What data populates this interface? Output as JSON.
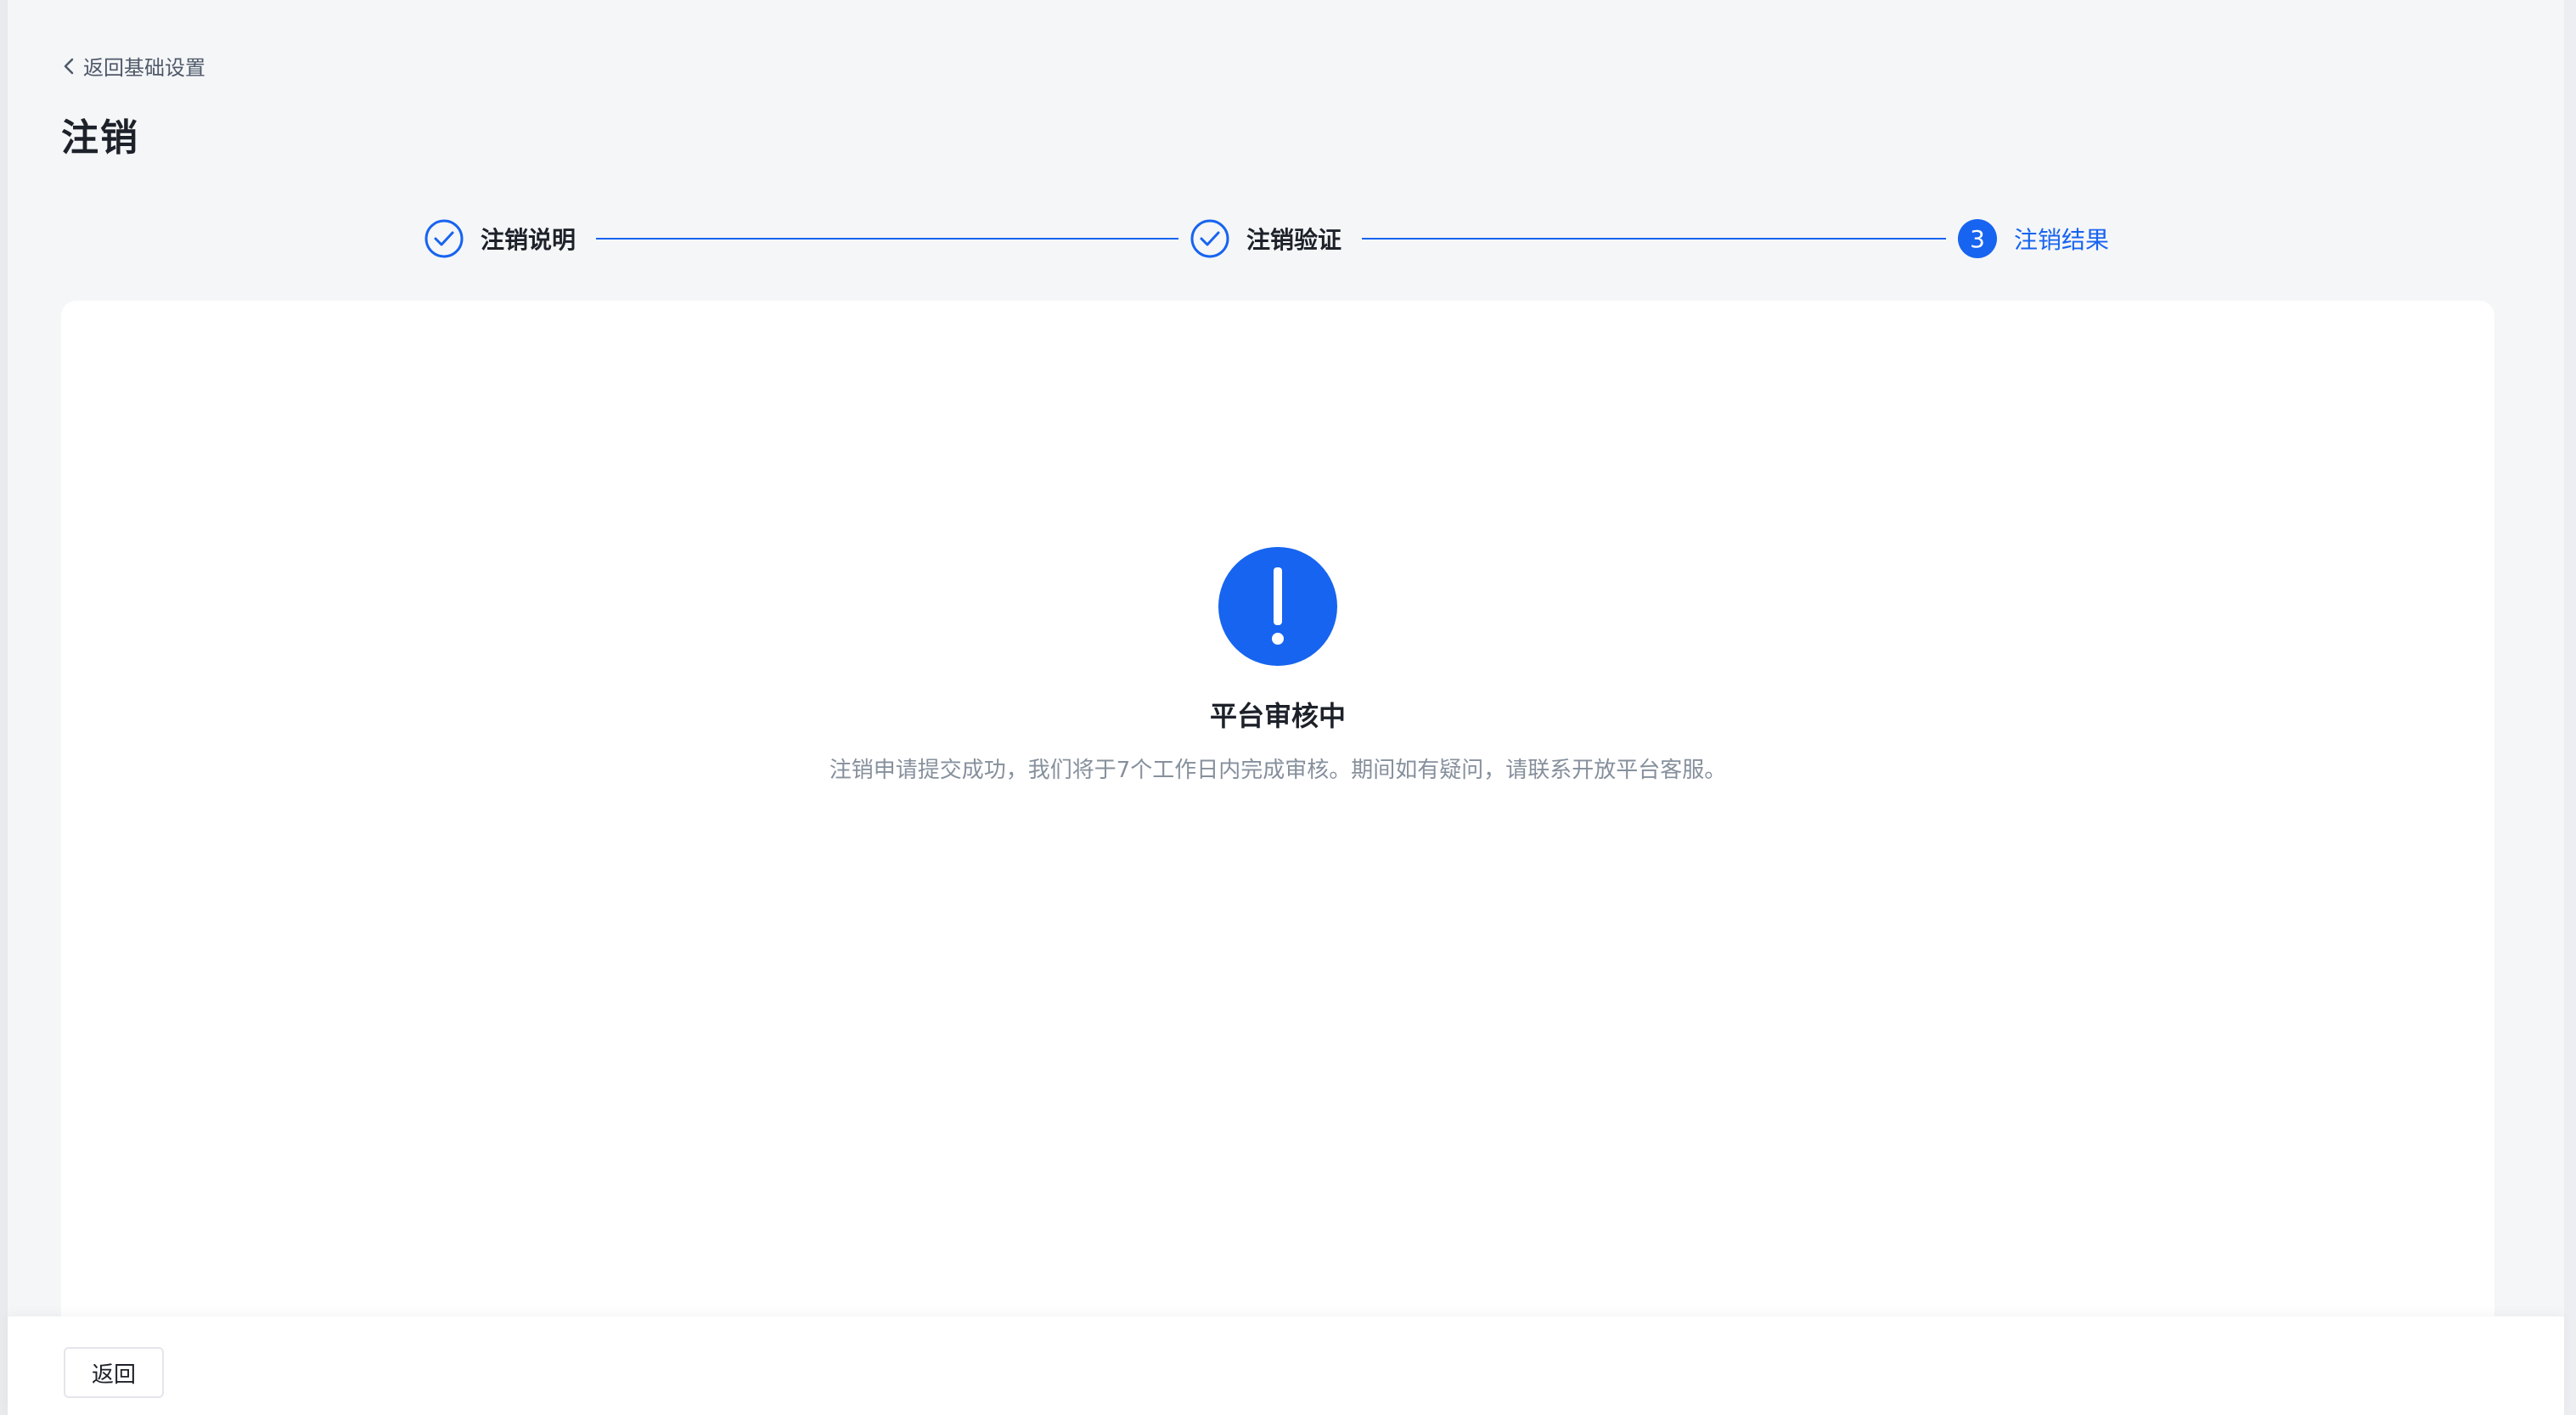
{
  "header": {
    "back_label": "返回基础设置",
    "title": "注销"
  },
  "steps": [
    {
      "label": "注销说明",
      "state": "done",
      "icon": "check-circle-icon"
    },
    {
      "label": "注销验证",
      "state": "done",
      "icon": "check-circle-icon"
    },
    {
      "label": "注销结果",
      "state": "active",
      "number": "3"
    }
  ],
  "result": {
    "icon": "exclamation-circle-icon",
    "title": "平台审核中",
    "description": "注销申请提交成功，我们将于7个工作日内完成审核。期间如有疑问，请联系开放平台客服。"
  },
  "footer": {
    "back_button": "返回"
  },
  "colors": {
    "primary": "#1764f0",
    "background": "#f5f6f8",
    "card": "#ffffff",
    "text_primary": "#1d2129",
    "text_secondary": "#86909c"
  }
}
